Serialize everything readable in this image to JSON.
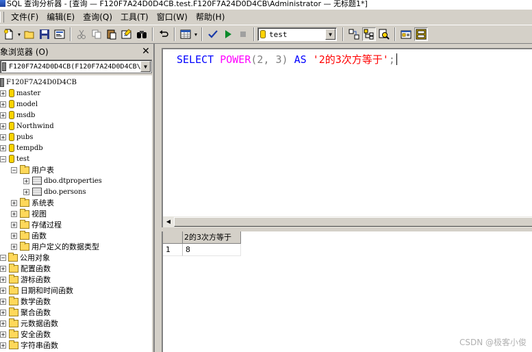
{
  "window": {
    "title": "SQL 查询分析器 - [查询 — F120F7A24D0D4CB.test.F120F7A24D0D4CB\\Administrator — 无标题1*]"
  },
  "menu": {
    "items": [
      "文件(F)",
      "编辑(E)",
      "查询(Q)",
      "工具(T)",
      "窗口(W)",
      "帮助(H)"
    ]
  },
  "toolbar": {
    "database_selected": "test"
  },
  "object_browser": {
    "title": "对象浏览器 (O)",
    "server_combo": "F120F7A24D0D4CB(F120F7A24D0D4CB\\",
    "tree": {
      "server": "F120F7A24D0D4CB",
      "databases": [
        "master",
        "model",
        "msdb",
        "Northwind",
        "pubs",
        "tempdb",
        "test"
      ],
      "test_children": {
        "user_tables": "用户表",
        "tables": [
          "dbo.dtproperties",
          "dbo.persons"
        ],
        "folders": [
          "系统表",
          "视图",
          "存储过程",
          "函数",
          "用户定义的数据类型"
        ]
      },
      "public_objects": "公用对象",
      "function_groups": [
        "配置函数",
        "游标函数",
        "日期和时间函数",
        "数学函数",
        "聚合函数",
        "元数据函数",
        "安全函数",
        "字符串函数"
      ]
    }
  },
  "editor": {
    "kw_select": "SELECT",
    "fn_power": "POWER",
    "paren_open": "(",
    "arg1": "2",
    "comma": ",",
    "arg2": "3",
    "paren_close": ")",
    "kw_as": "AS",
    "alias": "'2的3次方等于'",
    "semicolon": ";"
  },
  "results": {
    "columns": [
      "2的3次方等于"
    ],
    "rows": [
      {
        "index": "1",
        "values": [
          "8"
        ]
      }
    ]
  },
  "watermark": "CSDN @极客小俊",
  "colors": {
    "keyword": "#0000ff",
    "function": "#ff00ff",
    "string": "#ff0000",
    "punctuation": "#808080"
  }
}
